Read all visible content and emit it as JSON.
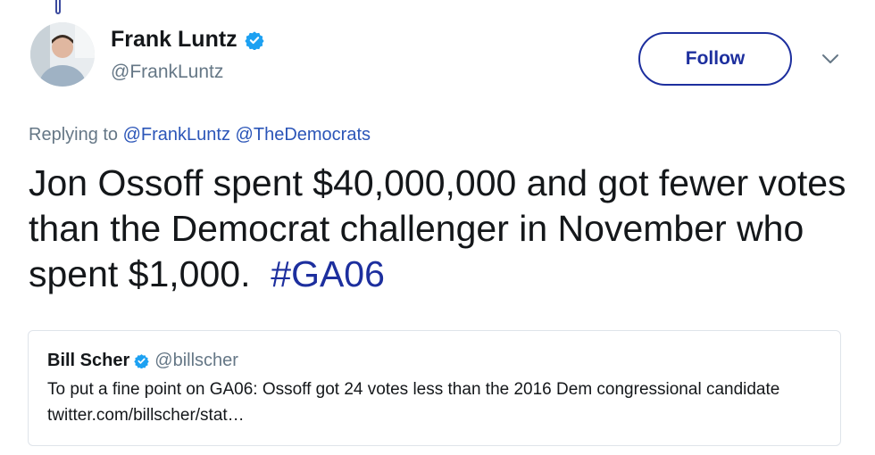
{
  "author": {
    "name": "Frank Luntz",
    "handle": "@FrankLuntz",
    "verified": true
  },
  "follow_button": {
    "label": "Follow"
  },
  "replying": {
    "prefix": "Replying to",
    "mentions": [
      "@FrankLuntz",
      "@TheDemocrats"
    ]
  },
  "tweet": {
    "text": "Jon Ossoff spent $40,000,000 and got fewer votes than the Democrat challenger in November who spent $1,000.  ",
    "hashtag": "#GA06"
  },
  "quoted_tweet": {
    "name": "Bill Scher",
    "handle": "@billscher",
    "verified": true,
    "text": "To put a fine point on GA06: Ossoff got 24 votes less than the 2016 Dem congressional candidate twitter.com/billscher/stat…"
  },
  "colors": {
    "accent": "#1d2f9e",
    "link": "#2b55b8",
    "verified": "#1da1f2",
    "muted": "#657786"
  },
  "icons": {
    "verified": "verified-badge-icon",
    "menu": "chevron-down-icon"
  }
}
